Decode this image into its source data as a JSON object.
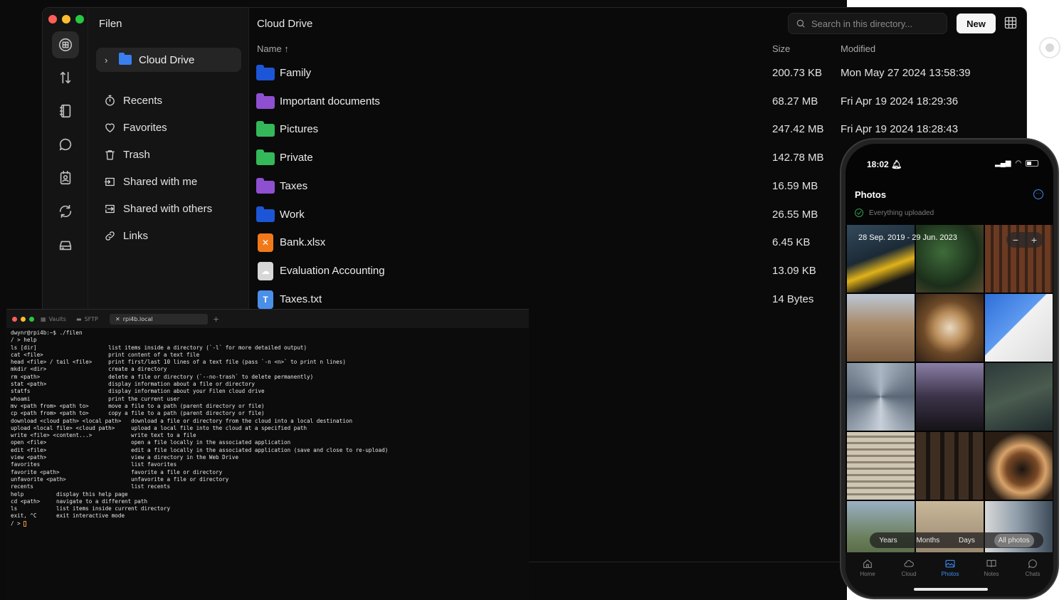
{
  "desktop": {
    "app_title": "Filen",
    "sidebar": {
      "drive": "Cloud Drive",
      "items": [
        {
          "label": "Recents",
          "icon": "stopwatch-icon"
        },
        {
          "label": "Favorites",
          "icon": "heart-icon"
        },
        {
          "label": "Trash",
          "icon": "trash-icon"
        },
        {
          "label": "Shared with me",
          "icon": "share-in-icon"
        },
        {
          "label": "Shared with others",
          "icon": "share-out-icon"
        },
        {
          "label": "Links",
          "icon": "link-icon"
        }
      ]
    },
    "main": {
      "title": "Cloud Drive",
      "search_placeholder": "Search in this directory...",
      "new_label": "New",
      "columns": {
        "name": "Name ↑",
        "size": "Size",
        "modified": "Modified"
      },
      "files": [
        {
          "name": "Family",
          "size": "200.73 KB",
          "modified": "Mon May 27 2024 13:58:39",
          "kind": "folder",
          "color": "#1c55d6"
        },
        {
          "name": "Important documents",
          "size": "68.27 MB",
          "modified": "Fri Apr 19 2024 18:29:36",
          "kind": "folder",
          "color": "#8e4fd1"
        },
        {
          "name": "Pictures",
          "size": "247.42 MB",
          "modified": "Fri Apr 19 2024 18:28:43",
          "kind": "folder",
          "color": "#34b85a"
        },
        {
          "name": "Private",
          "size": "142.78 MB",
          "modified": "",
          "kind": "folder",
          "color": "#34b85a"
        },
        {
          "name": "Taxes",
          "size": "16.59 MB",
          "modified": "",
          "kind": "folder",
          "color": "#8e4fd1"
        },
        {
          "name": "Work",
          "size": "26.55 MB",
          "modified": "",
          "kind": "folder",
          "color": "#1c55d6"
        },
        {
          "name": "Bank.xlsx",
          "size": "6.45 KB",
          "modified": "",
          "kind": "file",
          "color": "#f07a1a",
          "glyph": "✕"
        },
        {
          "name": "Evaluation Accounting",
          "size": "13.09 KB",
          "modified": "",
          "kind": "file",
          "color": "#d7d7d7",
          "glyph": "☁"
        },
        {
          "name": "Taxes.txt",
          "size": "14 Bytes",
          "modified": "",
          "kind": "file",
          "color": "#4a8fe8",
          "glyph": "T"
        }
      ]
    }
  },
  "terminal": {
    "tabs": [
      "Vaults",
      "SFTP",
      "rpi4b.local",
      "+"
    ],
    "lines": [
      "dwynr@rpi4b:~$ ./filen",
      "/ > help",
      "",
      "ls [dir]                      list items inside a directory (`-l` for more detailed output)",
      "cat <file>                    print content of a text file",
      "head <file> / tail <file>     print first/last 10 lines of a text file (pass `-n <n>` to print n lines)",
      "mkdir <dir>                   create a directory",
      "rm <path>                     delete a file or directory (`--no-trash` to delete permanently)",
      "stat <path>                   display information about a file or directory",
      "statfs                        display information about your Filen cloud drive",
      "whoami                        print the current user",
      "mv <path from> <path to>      move a file to a path (parent directory or file)",
      "cp <path from> <path to>      copy a file to a path (parent directory or file)",
      "",
      "download <cloud path> <local path>   download a file or directory from the cloud into a local destination",
      "upload <local file> <cloud path>     upload a local file into the cloud at a specified path",
      "write <file> <content...>            write text to a file",
      "open <file>                          open a file locally in the associated application",
      "edit <file>                          edit a file locally in the associated application (save and close to re-upload)",
      "view <path>                          view a directory in the Web Drive",
      "favorites                            list favorites",
      "favorite <path>                      favorite a file or directory",
      "unfavorite <path>                    unfavorite a file or directory",
      "recents                              list recents",
      "",
      "help          display this help page",
      "cd <path>     navigate to a different path",
      "ls            list items inside current directory",
      "exit, ^C      exit interactive mode",
      "",
      "/ > "
    ]
  },
  "phone": {
    "time": "18:02",
    "title": "Photos",
    "upload_status": "Everything uploaded",
    "date_range": "28 Sep. 2019 - 29 Jun. 2023",
    "zoom_minus": "−",
    "zoom_plus": "+",
    "segments": [
      "Years",
      "Months",
      "Days",
      "All photos"
    ],
    "active_segment": "All photos",
    "tabs": [
      "Home",
      "Cloud",
      "Photos",
      "Notes",
      "Chats"
    ],
    "active_tab": "Photos"
  }
}
